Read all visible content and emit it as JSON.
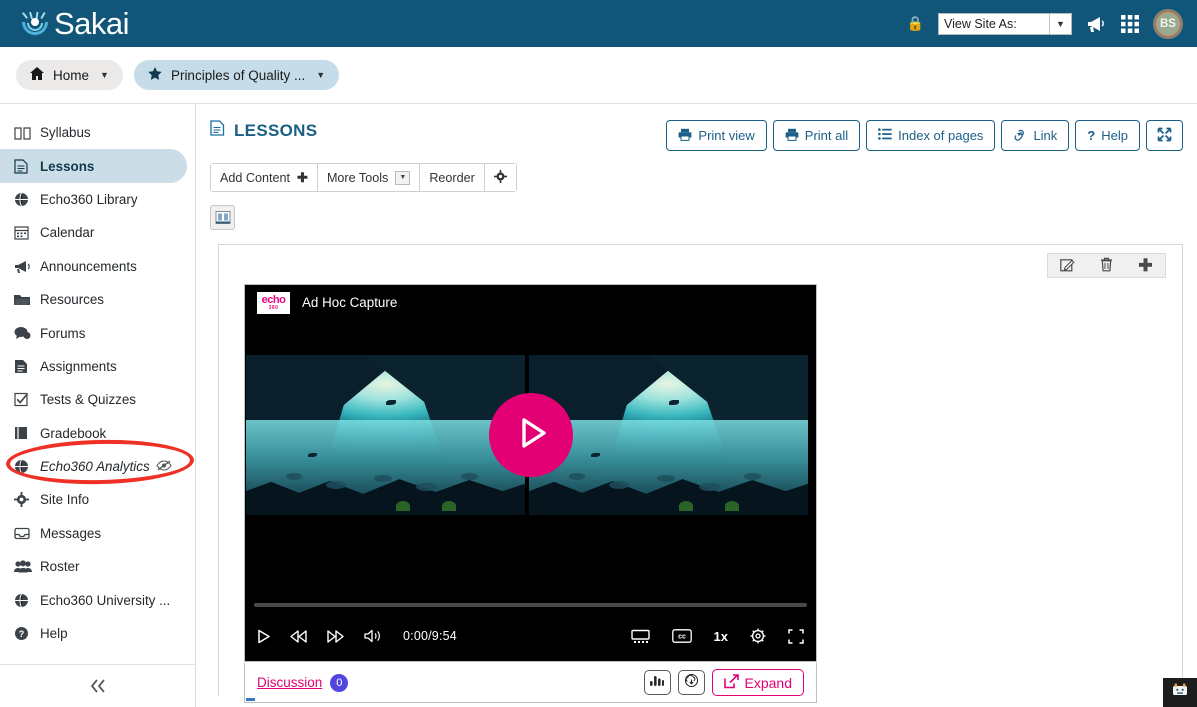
{
  "topbar": {
    "brand": "Sakai",
    "lock_icon": "lock-icon",
    "site_select": {
      "value": "View Site As:",
      "placeholder": "View Site As:"
    },
    "megaphone_icon": "megaphone-icon",
    "apps_icon": "apps-grid-icon",
    "avatar_initials": "BS"
  },
  "sitenav": {
    "tabs": [
      {
        "label": "Home",
        "icon": "home-icon"
      },
      {
        "label": "Principles of Quality ...",
        "icon": "star-icon"
      }
    ]
  },
  "sidebar": {
    "items": [
      {
        "label": "Syllabus",
        "icon": "book-icon"
      },
      {
        "label": "Lessons",
        "icon": "document-icon"
      },
      {
        "label": "Echo360 Library",
        "icon": "globe-icon"
      },
      {
        "label": "Calendar",
        "icon": "calendar-icon"
      },
      {
        "label": "Announcements",
        "icon": "megaphone-icon"
      },
      {
        "label": "Resources",
        "icon": "folder-icon"
      },
      {
        "label": "Forums",
        "icon": "chat-icon"
      },
      {
        "label": "Assignments",
        "icon": "assignment-icon"
      },
      {
        "label": "Tests & Quizzes",
        "icon": "checkbox-icon"
      },
      {
        "label": "Gradebook",
        "icon": "gradebook-icon"
      },
      {
        "label": "Echo360 Analytics",
        "icon": "globe-icon",
        "hidden_icon": "eye-slash-icon"
      },
      {
        "label": "Site Info",
        "icon": "gear-icon"
      },
      {
        "label": "Messages",
        "icon": "envelope-icon"
      },
      {
        "label": "Roster",
        "icon": "people-icon"
      },
      {
        "label": "Echo360 University ...",
        "icon": "globe-icon"
      },
      {
        "label": "Help",
        "icon": "question-circle-icon"
      }
    ],
    "collapse_icon": "double-chevron-left-icon"
  },
  "content": {
    "page_title": "LESSONS",
    "page_title_icon": "document-icon",
    "head_buttons": [
      {
        "label": "Print view",
        "icon": "printer-icon"
      },
      {
        "label": "Print all",
        "icon": "printer-icon"
      },
      {
        "label": "Index of pages",
        "icon": "list-icon"
      },
      {
        "label": "Link",
        "icon": "link-icon"
      },
      {
        "label": "Help",
        "icon": "question-mark-icon"
      },
      {
        "label": "",
        "icon": "expand-arrows-icon"
      }
    ],
    "toolbar": [
      {
        "label": "Add Content",
        "icon": "plus-icon"
      },
      {
        "label": "More Tools",
        "icon": "caret-down-icon"
      },
      {
        "label": "Reorder",
        "icon": ""
      },
      {
        "label": "",
        "icon": "gear-icon"
      }
    ],
    "layout_toggle_icon": "two-column-layout-icon",
    "card_tools": [
      {
        "icon": "edit-pencil-icon"
      },
      {
        "icon": "trash-icon"
      },
      {
        "icon": "plus-icon"
      }
    ]
  },
  "player": {
    "brand_top": "echo",
    "brand_bottom": "360",
    "title": "Ad Hoc Capture",
    "play_icon": "play-triangle-icon",
    "time": "0:00/9:54",
    "speed": "1x",
    "controls_left": [
      {
        "icon": "play-icon"
      },
      {
        "icon": "rewind-icon"
      },
      {
        "icon": "fast-forward-icon"
      },
      {
        "icon": "volume-icon"
      }
    ],
    "controls_right": [
      {
        "icon": "presentation-icon"
      },
      {
        "icon": "closed-caption-icon"
      },
      {
        "icon": "settings-gear-icon"
      },
      {
        "icon": "fullscreen-icon"
      }
    ],
    "discussion_label": "Discussion",
    "discussion_count": "0",
    "bar_chart_icon": "bar-chart-icon",
    "download_icon": "cloud-download-icon",
    "expand_label": "Expand",
    "expand_icon": "external-link-icon"
  },
  "footer": {
    "accessibility_icon": "accessibility-widget-icon"
  },
  "colors": {
    "header_blue": "#115679",
    "accent_pink": "#e20074",
    "link_blue": "#1b5f86",
    "annotation_red": "#ee3124",
    "badge_purple": "#5346e0",
    "active_nav": "#cbdde6"
  }
}
